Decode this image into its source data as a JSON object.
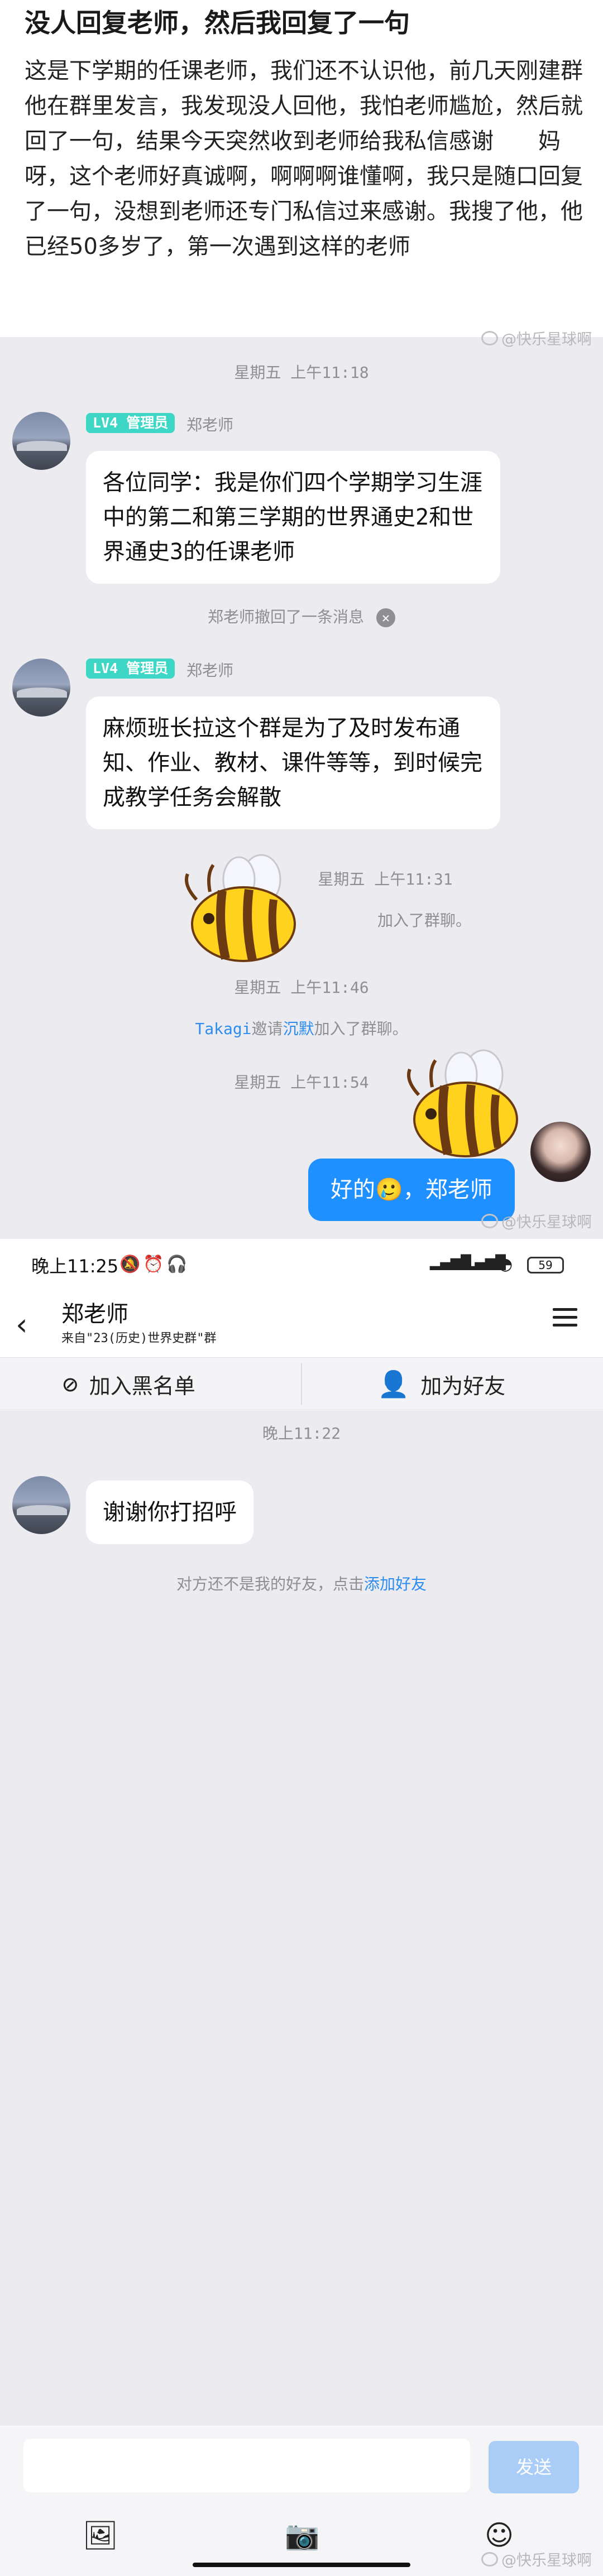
{
  "post": {
    "title": "没人回复老师，然后我回复了一句",
    "body": "这是下学期的任课老师，我们还不认识他，前几天刚建群他在群里发言，我发现没人回他，我怕老师尴尬，然后就回了一句，结果今天突然收到老师给我私信感谢　　妈呀，这个老师好真诚啊，啊啊啊谁懂啊，我只是随口回复了一句，没想到老师还专门私信过来感谢。我搜了他，他已经50多岁了，第一次遇到这样的老师"
  },
  "watermark": "@快乐星球啊",
  "group_chat": {
    "time1": "星期五 上午11:18",
    "msg1": {
      "badge": "LV4 管理员",
      "sender": "郑老师",
      "text": "各位同学：我是你们四个学期学习生涯中的第二和第三学期的世界通史2和世界通史3的任课老师"
    },
    "recall_text": "郑老师撤回了一条消息",
    "msg2": {
      "badge": "LV4 管理员",
      "sender": "郑老师",
      "text": "麻烦班长拉这个群是为了及时发布通知、作业、教材、课件等等，到时候完成教学任务会解散"
    },
    "time2": "星期五 上午11:31",
    "join1": "加入了群聊。",
    "time3": "星期五 上午11:46",
    "join2": {
      "inviter": "Takagi",
      "mid": "邀请",
      "invitee": "沉默",
      "tail": "加入了群聊。"
    },
    "time4": "星期五 上午11:54",
    "my_msg": "好的🥲，郑老师"
  },
  "status_bar": {
    "time": "晚上11:25",
    "battery": "59"
  },
  "private_chat": {
    "contact_name": "郑老师",
    "from_group": "来自\"23(历史)世界史群\"群",
    "blacklist_label": "加入黑名单",
    "add_friend_label": "加为好友",
    "time": "晚上11:22",
    "msg": "谢谢你打招呼",
    "notice_prefix": "对方还不是我的好友，点击",
    "notice_link": "添加好友",
    "send_label": "发送"
  }
}
